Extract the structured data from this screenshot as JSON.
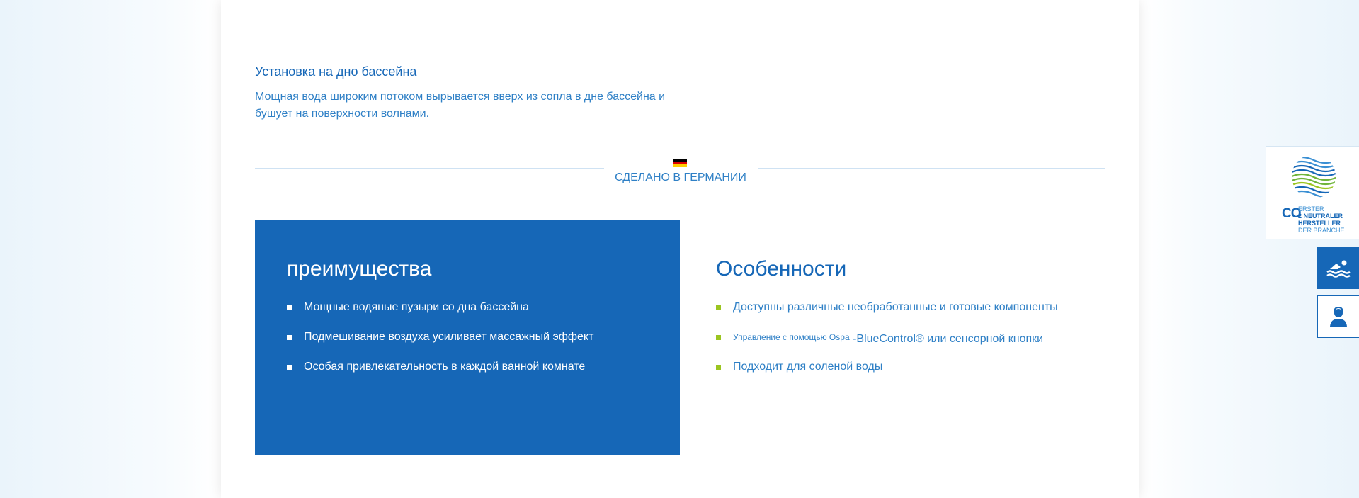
{
  "intro": {
    "title": "Установка на дно бассейна",
    "text": "Мощная вода широким потоком вырывается вверх из сопла в дне бассейна и бушует на поверхности волнами."
  },
  "made_in": {
    "label": "СДЕЛАНО В ГЕРМАНИИ",
    "flag_icon": "german-flag-icon",
    "flag_colors": [
      "#000000",
      "#dd0000",
      "#ffce00"
    ]
  },
  "advantages": {
    "title": "преимущества",
    "items": [
      "Мощные водяные пузыри со дна бассейна",
      "Подмешивание воздуха усиливает массажный эффект",
      "Особая привлекательность в каждой ванной комнате"
    ]
  },
  "features": {
    "title": "Особенности",
    "items": [
      {
        "text": "Доступны различные необработанные и готовые компоненты"
      },
      {
        "small": "Управление с помощью Ospa",
        "text": "-BlueControl® или сенсорной кнопки"
      },
      {
        "text": "Подходит для соленой воды"
      }
    ]
  },
  "co2_badge": {
    "big": "CO",
    "lines": [
      "ERSTER",
      "2 NEUTRALER",
      "HERSTELLER",
      "DER BRANCHE"
    ],
    "icon": "globe-wave-icon"
  },
  "side_buttons": [
    {
      "icon": "swimmer-icon"
    },
    {
      "icon": "contact-person-icon"
    }
  ],
  "colors": {
    "brand_blue": "#1667b7",
    "text_blue": "#2f80c6",
    "accent_green": "#9bc520"
  }
}
